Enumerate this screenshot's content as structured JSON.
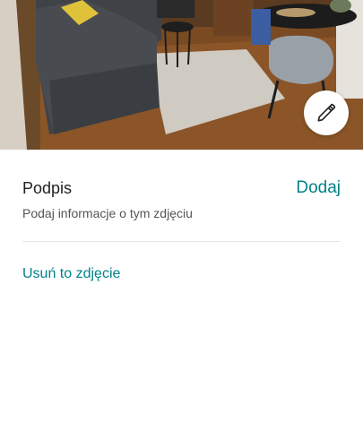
{
  "photo": {
    "alt_icon": "room-photo"
  },
  "edit_button": {
    "icon": "pencil-icon"
  },
  "caption": {
    "title": "Podpis",
    "add_label": "Dodaj",
    "hint": "Podaj informacje o tym zdjęciu"
  },
  "actions": {
    "remove_label": "Usuń to zdjęcie"
  },
  "colors": {
    "accent": "#00828a",
    "text_primary": "#222222",
    "text_secondary": "#555555",
    "divider": "#e4e4e4"
  }
}
